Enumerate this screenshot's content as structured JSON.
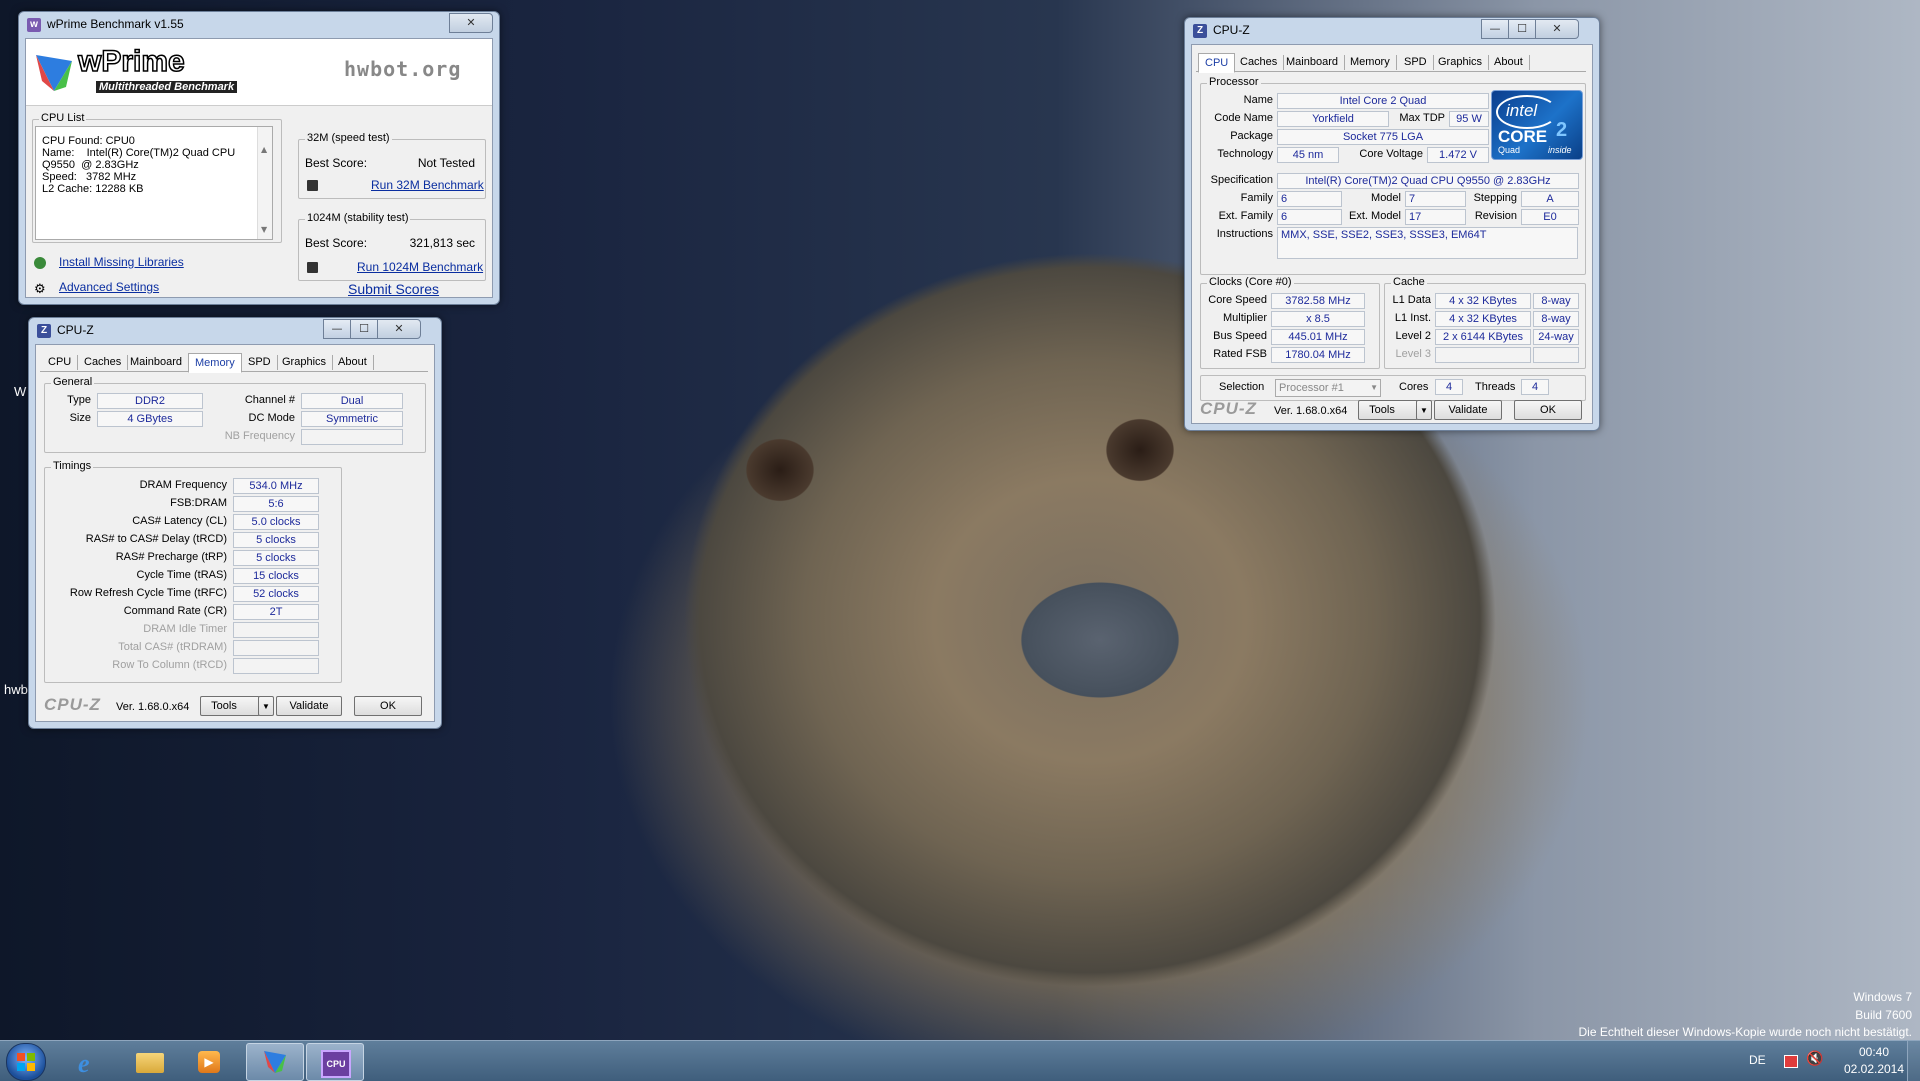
{
  "desktop": {
    "watermark_line1": "Windows 7",
    "watermark_line2": "Build 7600",
    "watermark_line3": "Die Echtheit dieser Windows-Kopie wurde noch nicht bestätigt.",
    "stray_w": "W",
    "stray_hwb": "hwb"
  },
  "wprime": {
    "title": "wPrime Benchmark v1.55",
    "logo_text": "wPrime",
    "logo_sub": "Multithreaded Benchmark",
    "hwbot_text": "hwbot.org",
    "cpu_list_label": "CPU List",
    "cpu_list_lines": [
      "CPU Found: CPU0",
      "Name:    Intel(R) Core(TM)2 Quad CPU",
      "Q9550  @ 2.83GHz",
      "Speed:   3782 MHz",
      "L2 Cache: 12288 KB"
    ],
    "speed_test_label": "32M (speed test)",
    "speed_best_label": "Best Score:",
    "speed_best_value": "Not Tested",
    "speed_run": "Run 32M Benchmark",
    "stability_label": "1024M (stability test)",
    "stab_best_label": "Best Score:",
    "stab_best_value": "321,813 sec",
    "stab_run": "Run 1024M Benchmark",
    "install_libs": "Install Missing Libraries",
    "advanced": "Advanced Settings",
    "submit": "Submit Scores"
  },
  "cpuz_mem": {
    "title": "CPU-Z",
    "tabs": [
      "CPU",
      "Caches",
      "Mainboard",
      "Memory",
      "SPD",
      "Graphics",
      "About"
    ],
    "active_tab": "Memory",
    "general_label": "General",
    "type_label": "Type",
    "type": "DDR2",
    "size_label": "Size",
    "size": "4 GBytes",
    "channel_label": "Channel #",
    "channel": "Dual",
    "dcmode_label": "DC Mode",
    "dcmode": "Symmetric",
    "nbfreq_label": "NB Frequency",
    "timings_label": "Timings",
    "timings": [
      {
        "label": "DRAM Frequency",
        "value": "534.0 MHz"
      },
      {
        "label": "FSB:DRAM",
        "value": "5:6"
      },
      {
        "label": "CAS# Latency (CL)",
        "value": "5.0 clocks"
      },
      {
        "label": "RAS# to CAS# Delay (tRCD)",
        "value": "5 clocks"
      },
      {
        "label": "RAS# Precharge (tRP)",
        "value": "5 clocks"
      },
      {
        "label": "Cycle Time (tRAS)",
        "value": "15 clocks"
      },
      {
        "label": "Row Refresh Cycle Time (tRFC)",
        "value": "52 clocks"
      },
      {
        "label": "Command Rate (CR)",
        "value": "2T"
      },
      {
        "label": "DRAM Idle Timer",
        "value": ""
      },
      {
        "label": "Total CAS# (tRDRAM)",
        "value": ""
      },
      {
        "label": "Row To Column (tRCD)",
        "value": ""
      }
    ],
    "logo": "CPU-Z",
    "version": "Ver. 1.68.0.x64",
    "tools": "Tools",
    "validate": "Validate",
    "ok": "OK"
  },
  "cpuz_cpu": {
    "title": "CPU-Z",
    "tabs": [
      "CPU",
      "Caches",
      "Mainboard",
      "Memory",
      "SPD",
      "Graphics",
      "About"
    ],
    "active_tab": "CPU",
    "processor_label": "Processor",
    "name_label": "Name",
    "name": "Intel Core 2 Quad",
    "codename_label": "Code Name",
    "codename": "Yorkfield",
    "maxtdp_label": "Max TDP",
    "maxtdp": "95 W",
    "package_label": "Package",
    "package": "Socket 775 LGA",
    "technology_label": "Technology",
    "technology": "45 nm",
    "corevoltage_label": "Core Voltage",
    "corevoltage": "1.472 V",
    "spec_label": "Specification",
    "spec": "Intel(R) Core(TM)2 Quad CPU    Q9550  @ 2.83GHz",
    "family_label": "Family",
    "family": "6",
    "model_label": "Model",
    "model": "7",
    "stepping_label": "Stepping",
    "stepping": "A",
    "extfamily_label": "Ext. Family",
    "extfamily": "6",
    "extmodel_label": "Ext. Model",
    "extmodel": "17",
    "revision_label": "Revision",
    "revision": "E0",
    "instructions_label": "Instructions",
    "instructions": "MMX, SSE, SSE2, SSE3, SSSE3, EM64T",
    "clocks_label": "Clocks (Core #0)",
    "corespeed_label": "Core Speed",
    "corespeed": "3782.58 MHz",
    "multiplier_label": "Multiplier",
    "multiplier": "x 8.5",
    "busspeed_label": "Bus Speed",
    "busspeed": "445.01 MHz",
    "ratedfsb_label": "Rated FSB",
    "ratedfsb": "1780.04 MHz",
    "cache_label": "Cache",
    "l1d_label": "L1 Data",
    "l1d": "4 x 32 KBytes",
    "l1d_way": "8-way",
    "l1i_label": "L1 Inst.",
    "l1i": "4 x 32 KBytes",
    "l1i_way": "8-way",
    "l2_label": "Level 2",
    "l2": "2 x 6144 KBytes",
    "l2_way": "24-way",
    "l3_label": "Level 3",
    "selection_label": "Selection",
    "selection": "Processor #1",
    "cores_label": "Cores",
    "cores": "4",
    "threads_label": "Threads",
    "threads": "4",
    "intel_logo_top": "intel",
    "intel_logo_mid": "CORE",
    "intel_logo_quad": "Quad",
    "intel_logo_inside": "inside",
    "logo": "CPU-Z",
    "version": "Ver. 1.68.0.x64",
    "tools": "Tools",
    "validate": "Validate",
    "ok": "OK"
  },
  "taskbar": {
    "lang": "DE",
    "time": "00:40",
    "date": "02.02.2014"
  },
  "colors": {
    "value_text": "#1d2a9b",
    "link": "#0a2ea0",
    "taskbar": "#4f6e8c"
  }
}
